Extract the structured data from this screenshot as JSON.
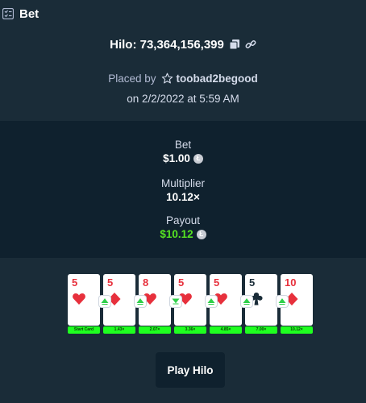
{
  "header": {
    "title": "Bet",
    "icon": "ticket-list-icon"
  },
  "game": {
    "label": "Hilo: 73,364,156,399",
    "copy_icon": "copy-icon",
    "link_icon": "link-icon"
  },
  "placed": {
    "prefix": "Placed by",
    "username": "toobad2begood",
    "date": "on 2/2/2022 at 5:59 AM"
  },
  "stats": {
    "bet_label": "Bet",
    "bet_value": "$1.00",
    "multiplier_label": "Multiplier",
    "multiplier_value": "10.12×",
    "payout_label": "Payout",
    "payout_value": "$10.12",
    "currency_icon": "litecoin-icon",
    "payout_color": "#56e322"
  },
  "cards": [
    {
      "rank": "5",
      "suit": "hearts",
      "color": "red",
      "badge": "Start Card"
    },
    {
      "rank": "5",
      "suit": "diamonds",
      "color": "red",
      "badge": "1.43×",
      "guess": "higher"
    },
    {
      "rank": "8",
      "suit": "hearts",
      "color": "red",
      "badge": "2.07×",
      "guess": "higher"
    },
    {
      "rank": "5",
      "suit": "hearts",
      "color": "red",
      "badge": "3.36×",
      "guess": "lower"
    },
    {
      "rank": "5",
      "suit": "hearts",
      "color": "red",
      "badge": "4.85×",
      "guess": "higher"
    },
    {
      "rank": "5",
      "suit": "clubs",
      "color": "black",
      "badge": "7.00×",
      "guess": "higher"
    },
    {
      "rank": "10",
      "suit": "diamonds",
      "color": "red",
      "badge": "10.12×",
      "guess": "higher"
    }
  ],
  "actions": {
    "play_label": "Play Hilo"
  },
  "colors": {
    "background": "#1a2c38",
    "panel": "#0f212e",
    "badge_green": "#1fff20",
    "card_red": "#e7303c"
  }
}
